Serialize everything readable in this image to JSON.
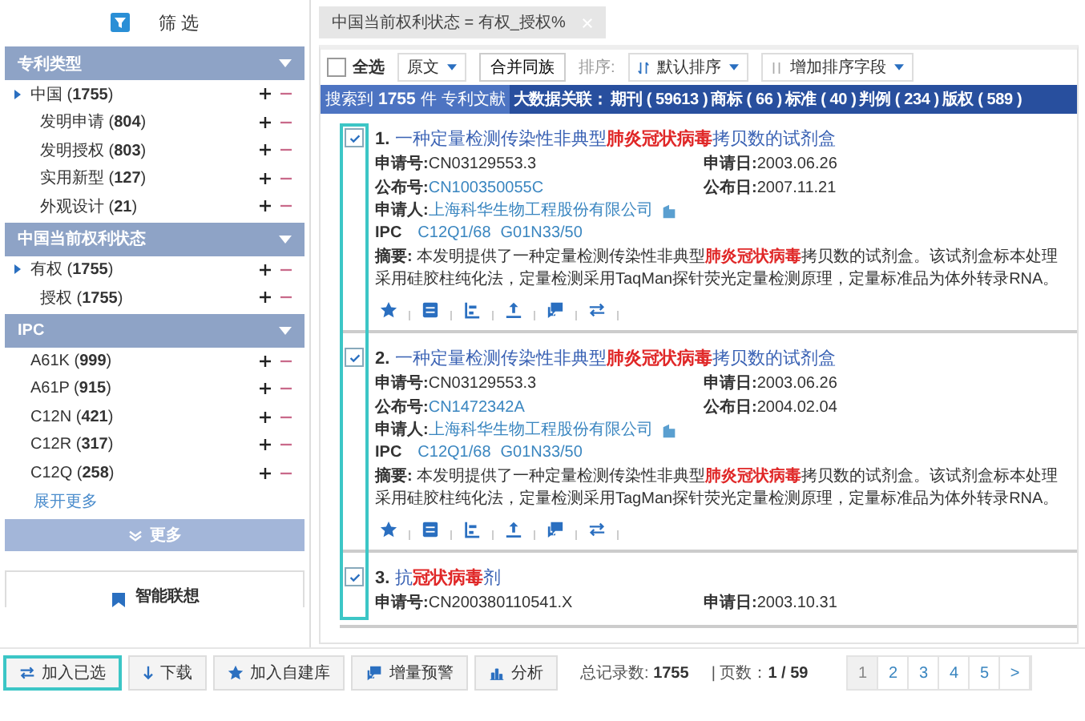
{
  "sidebar": {
    "title": "筛 选",
    "sections": [
      {
        "title": "专利类型",
        "expanded": true,
        "items": [
          {
            "label": "中国 (**1755**)",
            "expanded": true,
            "children": [
              {
                "label": "发明申请 (**804**)"
              },
              {
                "label": "发明授权 (**803**)"
              },
              {
                "label": "实用新型 (**127**)"
              },
              {
                "label": "外观设计 (**21**)"
              }
            ]
          }
        ]
      },
      {
        "title": "中国当前权利状态",
        "expanded": true,
        "items": [
          {
            "label": "有权 (**1755**)",
            "expanded": true,
            "children": [
              {
                "label": "授权 (**1755**)"
              }
            ]
          }
        ]
      },
      {
        "title": "IPC",
        "expanded": true,
        "items": [
          {
            "label": "A61K (**999**)"
          },
          {
            "label": "A61P (**915**)"
          },
          {
            "label": "C12N (**421**)"
          },
          {
            "label": "C12R (**317**)"
          },
          {
            "label": "C12Q (**258**)"
          }
        ],
        "more_link": "展开更多"
      }
    ],
    "more_button": "更多",
    "assoc_card": "智能联想"
  },
  "filter_tag": "中国当前权利状态 = 有权_授权%",
  "toolbar": {
    "select_all": {
      "label": "全选",
      "checked": false
    },
    "view_dropdown": "原文",
    "merge_button": "合并同族",
    "sort_label": "排序:",
    "sort_dropdown": "默认排序",
    "add_sort_field": "增加排序字段"
  },
  "summary": {
    "found": "搜索到",
    "count": "1755",
    "unit": "件",
    "kind": "专利文献",
    "assoc_label": "大数据关联：",
    "assoc": [
      "期刊 ( 59613 )",
      "商标 ( 66 )",
      "标准 ( 40 )",
      "判例 ( 234 )",
      "版权 ( 589 )"
    ]
  },
  "checkbox_column_outlined": true,
  "results": [
    {
      "number": "1.",
      "checked": true,
      "actions_visible": true,
      "title": [
        {
          "text": "一种定量检测传染性非典型",
          "highlight": false
        },
        {
          "text": "肺炎冠状病毒",
          "highlight": true
        },
        {
          "text": "拷贝数的试剂盒",
          "highlight": false
        }
      ],
      "rows": [
        {
          "kind": "pair",
          "cells": [
            {
              "label": "申请号:",
              "value": "CN03129553.3",
              "link": false
            },
            {
              "label": "申请日:",
              "value": "2003.06.26",
              "link": false
            }
          ]
        },
        {
          "kind": "pair",
          "cells": [
            {
              "label": "公布号:",
              "value": "CN100350055C",
              "link": true
            },
            {
              "label": "公布日:",
              "value": "2007.11.21",
              "link": false
            }
          ]
        },
        {
          "kind": "applicant",
          "cells": [
            {
              "label": "申请人:",
              "value": "上海科华生物工程股份有限公司",
              "link": true
            }
          ]
        },
        {
          "kind": "ipc",
          "cells": [
            {
              "label": "IPC",
              "value": "C12Q1/68",
              "link": true
            },
            {
              "value": "G01N33/50",
              "link": true
            }
          ]
        },
        {
          "kind": "abstract",
          "label": "摘要:",
          "parts": [
            {
              "text": "本发明提供了一种定量检测传染性非典型",
              "highlight": false
            },
            {
              "text": "肺炎冠状病毒",
              "highlight": true
            },
            {
              "text": "拷贝数的试剂盒。该试剂盒标本处理采用硅胶柱纯化法，定量检测采用TaqMan探针荧光定量检测原理，定量标准品为体外转录RNA。",
              "highlight": false
            }
          ]
        }
      ]
    },
    {
      "number": "2.",
      "checked": true,
      "actions_visible": true,
      "title": [
        {
          "text": "一种定量检测传染性非典型",
          "highlight": false
        },
        {
          "text": "肺炎冠状病毒",
          "highlight": true
        },
        {
          "text": "拷贝数的试剂盒",
          "highlight": false
        }
      ],
      "rows": [
        {
          "kind": "pair",
          "cells": [
            {
              "label": "申请号:",
              "value": "CN03129553.3",
              "link": false
            },
            {
              "label": "申请日:",
              "value": "2003.06.26",
              "link": false
            }
          ]
        },
        {
          "kind": "pair",
          "cells": [
            {
              "label": "公布号:",
              "value": "CN1472342A",
              "link": true
            },
            {
              "label": "公布日:",
              "value": "2004.02.04",
              "link": false
            }
          ]
        },
        {
          "kind": "applicant",
          "cells": [
            {
              "label": "申请人:",
              "value": "上海科华生物工程股份有限公司",
              "link": true
            }
          ]
        },
        {
          "kind": "ipc",
          "cells": [
            {
              "label": "IPC",
              "value": "C12Q1/68",
              "link": true
            },
            {
              "value": "G01N33/50",
              "link": true
            }
          ]
        },
        {
          "kind": "abstract",
          "label": "摘要:",
          "parts": [
            {
              "text": "本发明提供了一种定量检测传染性非典型",
              "highlight": false
            },
            {
              "text": "肺炎冠状病毒",
              "highlight": true
            },
            {
              "text": "拷贝数的试剂盒。该试剂盒标本处理采用硅胶柱纯化法，定量检测采用TagMan探针荧光定量检测原理，定量标准品为体外转录RNA。",
              "highlight": false
            }
          ]
        }
      ]
    },
    {
      "number": "3.",
      "checked": true,
      "actions_visible": false,
      "title": [
        {
          "text": "抗",
          "highlight": false
        },
        {
          "text": "冠状病毒",
          "highlight": true
        },
        {
          "text": "剂",
          "highlight": false
        }
      ],
      "rows": [
        {
          "kind": "pair",
          "cells": [
            {
              "label": "申请号:",
              "value": "CN200380110541.X",
              "link": false
            },
            {
              "label": "申请日:",
              "value": "2003.10.31",
              "link": false
            }
          ]
        }
      ]
    }
  ],
  "bottom_buttons": [
    {
      "kind": "add",
      "label": "加入已选",
      "outlined": true
    },
    {
      "kind": "download",
      "label": "下载",
      "outlined": false
    },
    {
      "kind": "library",
      "label": "加入自建库",
      "outlined": false
    },
    {
      "kind": "alert",
      "label": "增量预警",
      "outlined": false
    },
    {
      "kind": "analyze",
      "label": "分析",
      "outlined": false
    }
  ],
  "total": "总记录数: **1755**",
  "pages": "| 页数：**1 / 59**",
  "pagination": [
    {
      "label": "1",
      "selected": true
    },
    {
      "label": "2",
      "selected": false
    },
    {
      "label": "3",
      "selected": false
    },
    {
      "label": "4",
      "selected": false
    },
    {
      "label": "5",
      "selected": false
    },
    {
      "label": ">",
      "selected": false
    }
  ]
}
